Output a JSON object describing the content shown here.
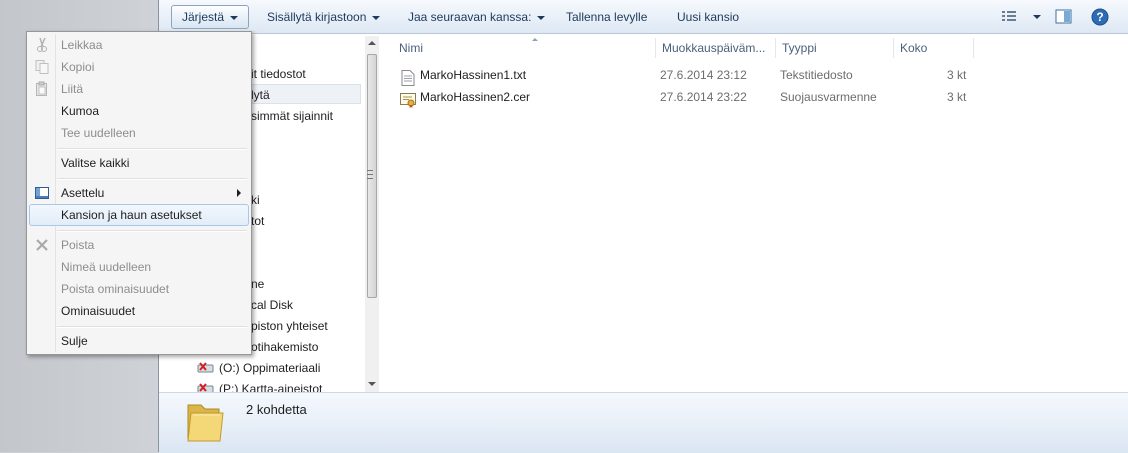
{
  "toolbar": {
    "organize": "Järjestä",
    "include_library": "Sisällytä kirjastoon",
    "share_with": "Jaa seuraavan kanssa:",
    "burn": "Tallenna levylle",
    "new_folder": "Uusi kansio"
  },
  "nav": {
    "items": [
      "it tiedostot",
      "lytä",
      "simmät sijainnit",
      "ki",
      "tot",
      "ne",
      "cal Disk",
      "piston yhteiset",
      "otihakemisto",
      "(O:) Oppimateriaali",
      "(P:) Kartta-aineistot"
    ]
  },
  "columns": {
    "name": "Nimi",
    "modified": "Muokkauspäiväm...",
    "type": "Tyyppi",
    "size": "Koko"
  },
  "files": [
    {
      "name": "MarkoHassinen1.txt",
      "modified": "27.6.2014 23:12",
      "type": "Tekstitiedosto",
      "size": "3 kt",
      "icon": "text-file-icon"
    },
    {
      "name": "MarkoHassinen2.cer",
      "modified": "27.6.2014 23:22",
      "type": "Suojausvarmenne",
      "size": "3 kt",
      "icon": "certificate-file-icon"
    }
  ],
  "status": {
    "count": "2 kohdetta"
  },
  "menu": {
    "items": [
      {
        "label": "Leikkaa",
        "enabled": false,
        "icon": "scissors-icon"
      },
      {
        "label": "Kopioi",
        "enabled": false,
        "icon": "copy-icon"
      },
      {
        "label": "Liitä",
        "enabled": false,
        "icon": "paste-icon"
      },
      {
        "label": "Kumoa",
        "enabled": true
      },
      {
        "label": "Tee uudelleen",
        "enabled": false
      },
      {
        "label": "Valitse kaikki",
        "enabled": true
      },
      {
        "label": "Asettelu",
        "enabled": true,
        "icon": "layout-icon",
        "submenu": true
      },
      {
        "label": "Kansion ja haun asetukset",
        "enabled": true,
        "hover": true
      },
      {
        "label": "Poista",
        "enabled": false,
        "icon": "delete-icon"
      },
      {
        "label": "Nimeä uudelleen",
        "enabled": false
      },
      {
        "label": "Poista ominaisuudet",
        "enabled": false
      },
      {
        "label": "Ominaisuudet",
        "enabled": true
      },
      {
        "label": "Sulje",
        "enabled": true
      }
    ]
  },
  "colors": {
    "toolbar_text": "#1e395b",
    "hover_border": "#a8c8ea",
    "disabled_text": "#8d8d8d"
  }
}
